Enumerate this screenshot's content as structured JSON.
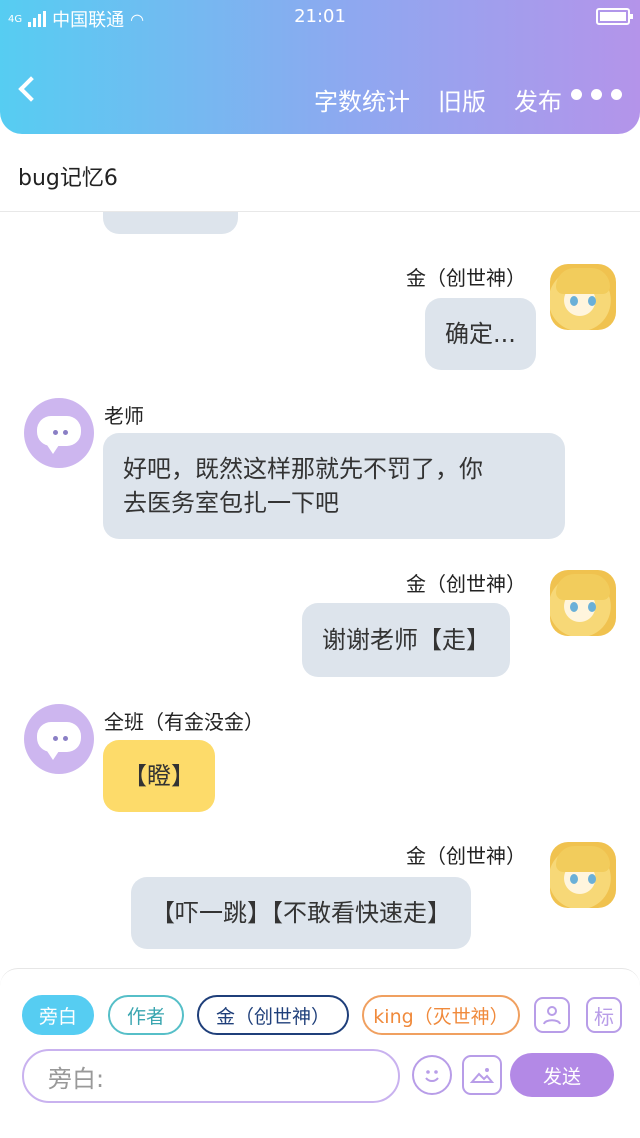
{
  "status_bar": {
    "network": "4G",
    "carrier": "中国联通",
    "time": "21:01"
  },
  "nav": {
    "word_count": "字数统计",
    "old_version": "旧版",
    "publish": "发布"
  },
  "title": "bug记忆6",
  "messages": [
    {
      "side": "right",
      "name": "金（创世神）",
      "text": "确定..."
    },
    {
      "side": "left",
      "name": "老师",
      "lines": [
        "好吧，既然这样那就先不罚了，你",
        "去医务室包扎一下吧"
      ]
    },
    {
      "side": "right",
      "name": "金（创世神）",
      "text": "谢谢老师【走】"
    },
    {
      "side": "left",
      "name": "全班（有金没金）",
      "text": "【瞪】",
      "color": "#fddb6a"
    },
    {
      "side": "right",
      "name": "金（创世神）",
      "text": "【吓一跳】【不敢看快速走】"
    }
  ],
  "roles": {
    "narration": "旁白",
    "author": "作者",
    "char1": "金（创世神）",
    "char2": "king（灭世神）"
  },
  "tools": {
    "mark": "标"
  },
  "input": {
    "placeholder": "旁白:"
  },
  "send_label": "发送",
  "colors": {
    "header_start": "#56cdf2",
    "header_end": "#b494ea",
    "bubble": "#dde4ec",
    "accent": "#b389e6"
  }
}
